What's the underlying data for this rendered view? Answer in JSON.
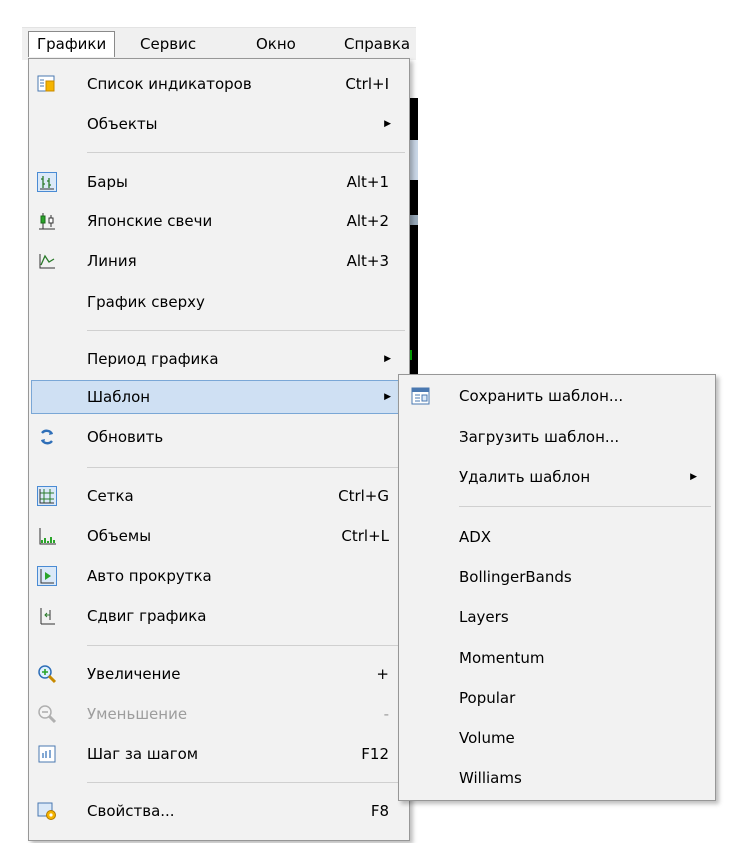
{
  "menubar": {
    "items": [
      {
        "label": "Графики"
      },
      {
        "label": "Сервис"
      },
      {
        "label": "Окно"
      },
      {
        "label": "Справка"
      }
    ]
  },
  "charts_menu": {
    "items": [
      {
        "label": "Список индикаторов",
        "shortcut": "Ctrl+I",
        "icon": "indicator-list-icon"
      },
      {
        "label": "Объекты",
        "submenu": true
      },
      {
        "label": "Бары",
        "shortcut": "Alt+1",
        "icon": "bar-chart-icon"
      },
      {
        "label": "Японские свечи",
        "shortcut": "Alt+2",
        "icon": "candlestick-icon"
      },
      {
        "label": "Линия",
        "shortcut": "Alt+3",
        "icon": "line-chart-icon"
      },
      {
        "label": "График сверху"
      },
      {
        "label": "Период графика",
        "submenu": true
      },
      {
        "label": "Шаблон",
        "submenu": true,
        "highlighted": true
      },
      {
        "label": "Обновить",
        "icon": "refresh-icon"
      },
      {
        "label": "Сетка",
        "shortcut": "Ctrl+G",
        "icon": "grid-icon"
      },
      {
        "label": "Объемы",
        "shortcut": "Ctrl+L",
        "icon": "volumes-icon"
      },
      {
        "label": "Авто прокрутка",
        "icon": "auto-scroll-icon"
      },
      {
        "label": "Сдвиг графика",
        "icon": "chart-shift-icon"
      },
      {
        "label": "Увеличение",
        "shortcut": "+",
        "icon": "zoom-in-icon"
      },
      {
        "label": "Уменьшение",
        "shortcut": "-",
        "icon": "zoom-out-icon",
        "disabled": true
      },
      {
        "label": "Шаг за шагом",
        "shortcut": "F12",
        "icon": "step-icon"
      },
      {
        "label": "Свойства...",
        "shortcut": "F8",
        "icon": "properties-icon"
      }
    ]
  },
  "template_submenu": {
    "items": [
      {
        "label": "Сохранить шаблон...",
        "icon": "save-template-icon"
      },
      {
        "label": "Загрузить шаблон..."
      },
      {
        "label": "Удалить шаблон",
        "submenu": true
      },
      {
        "label": "ADX"
      },
      {
        "label": "BollingerBands"
      },
      {
        "label": "Layers"
      },
      {
        "label": "Momentum"
      },
      {
        "label": "Popular"
      },
      {
        "label": "Volume"
      },
      {
        "label": "Williams"
      }
    ]
  },
  "colors": {
    "highlight_bg": "#cfe0f3",
    "highlight_border": "#7aa7d6",
    "menu_bg": "#f2f2f2",
    "disabled_text": "#9d9d9d"
  }
}
